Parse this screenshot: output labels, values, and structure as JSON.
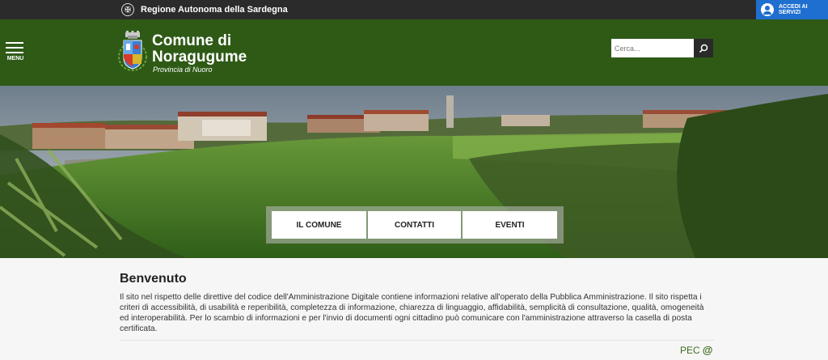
{
  "topbar": {
    "region_label": "Regione Autonoma della Sardegna",
    "login_label": "ACCEDI AI SERVIZI"
  },
  "header": {
    "menu_label": "MENU",
    "title_line1": "Comune di",
    "title_line2": "Noragugume",
    "subtitle": "Provincia di Nuoro",
    "search_placeholder": "Cerca..."
  },
  "hero_nav": [
    "IL COMUNE",
    "CONTATTI",
    "EVENTI"
  ],
  "main": {
    "heading": "Benvenuto",
    "intro": "Il sito nel rispetto delle direttive del codice dell'Amministrazione Digitale contiene informazioni relative all'operato della Pubblica Amministrazione. Il sito rispetta i criteri di accessibilità, di usabilità e reperibilità, completezza di informazione, chiarezza di linguaggio, affidabilità, semplicità di consultazione, qualità, omogeneità ed interoperabilità. Per lo scambio di informazioni e per l'invio di documenti ogni cittadino può comunicare con l'amministrazione attraverso la casella di posta certificata.",
    "pec_label": "PEC"
  },
  "colors": {
    "header_green": "#2e5a16",
    "topbar": "#2b2b2b",
    "login_blue": "#1f6fd0",
    "pec_green": "#3c6b1e"
  },
  "icons": {
    "region": "region-logo-icon",
    "login": "user-icon",
    "menu": "hamburger-icon",
    "crest": "municipal-crest-icon",
    "search": "search-icon",
    "pec": "at-sign-icon"
  }
}
